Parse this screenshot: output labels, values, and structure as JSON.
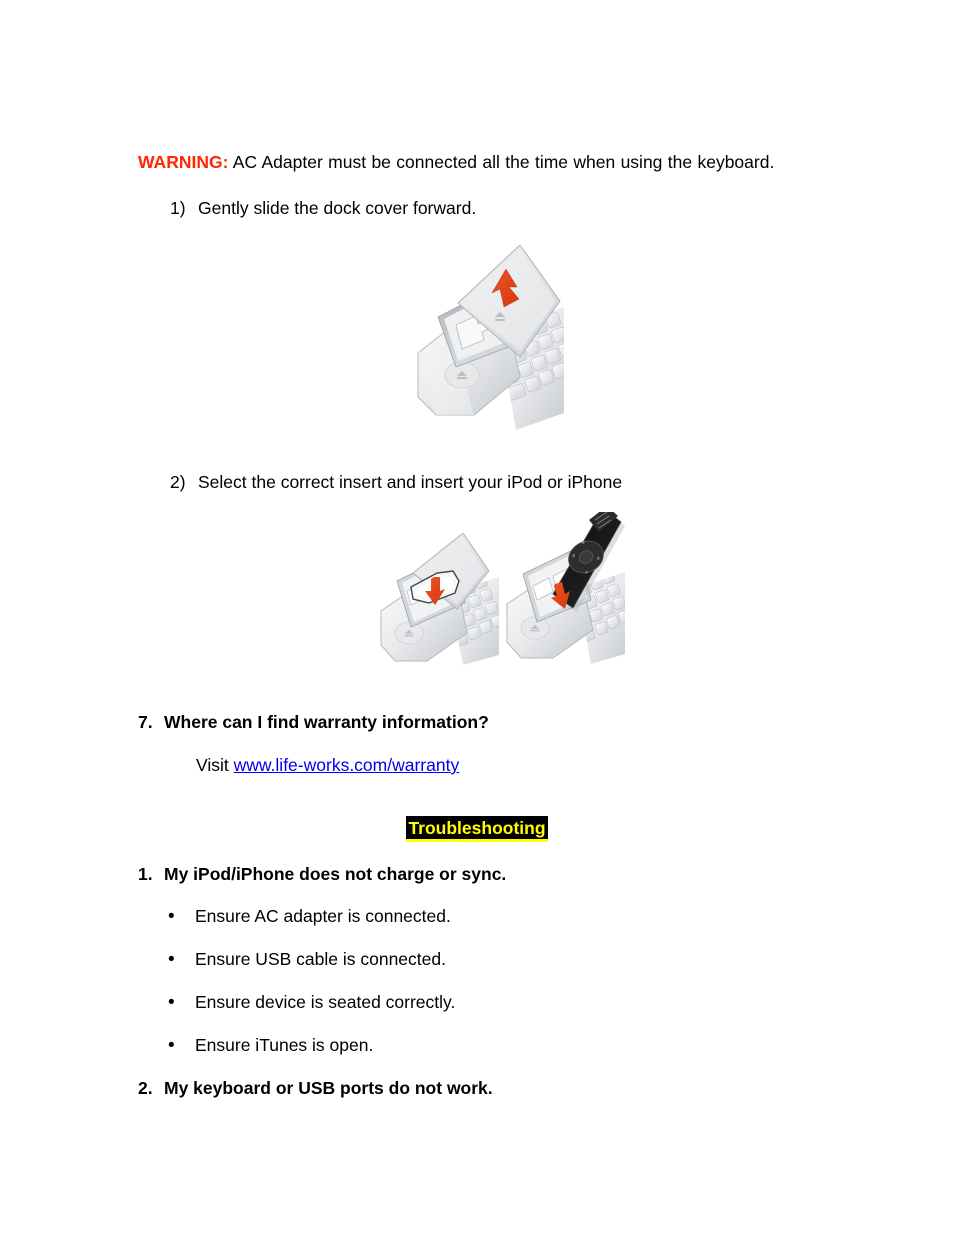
{
  "document": {
    "warning": {
      "label": "WARNING:",
      "text": " AC Adapter must be connected all the time when using the keyboard."
    },
    "steps": [
      {
        "number": "1)",
        "text": "Gently slide the dock cover forward."
      },
      {
        "number": "2)",
        "text": "Select the correct insert and insert your iPod or iPhone"
      }
    ],
    "figures": [
      {
        "name": "dock-cover-slide-figure",
        "caption_icon": "up-arrow-icon",
        "arrow_color": "#E0401A"
      },
      {
        "name": "insert-adapter-figure",
        "caption_icon": "down-arrow-icon",
        "arrow_color": "#E0401A"
      },
      {
        "name": "ipod-insert-figure",
        "caption_icon": "down-arrow-icon",
        "arrow_color": "#E0401A"
      }
    ],
    "warranty_question": {
      "number": "7.",
      "text": "Where can I find warranty information?",
      "answer_prefix": "Visit ",
      "link_text": "www.life-works.com/warranty",
      "link_color": "#0000EE"
    },
    "troubleshooting": {
      "heading": "Troubleshooting",
      "heading_text_color": "#FFFF00",
      "heading_background_color": "#000000",
      "items": [
        {
          "number": "1.",
          "text": "My iPod/iPhone does not charge or sync.",
          "bullets": [
            "Ensure AC adapter is connected.",
            "Ensure USB cable is connected.",
            "Ensure device is seated correctly.",
            "Ensure iTunes is open."
          ]
        },
        {
          "number": "2.",
          "text": "My keyboard or USB ports do not work.",
          "bullets": []
        }
      ]
    }
  }
}
